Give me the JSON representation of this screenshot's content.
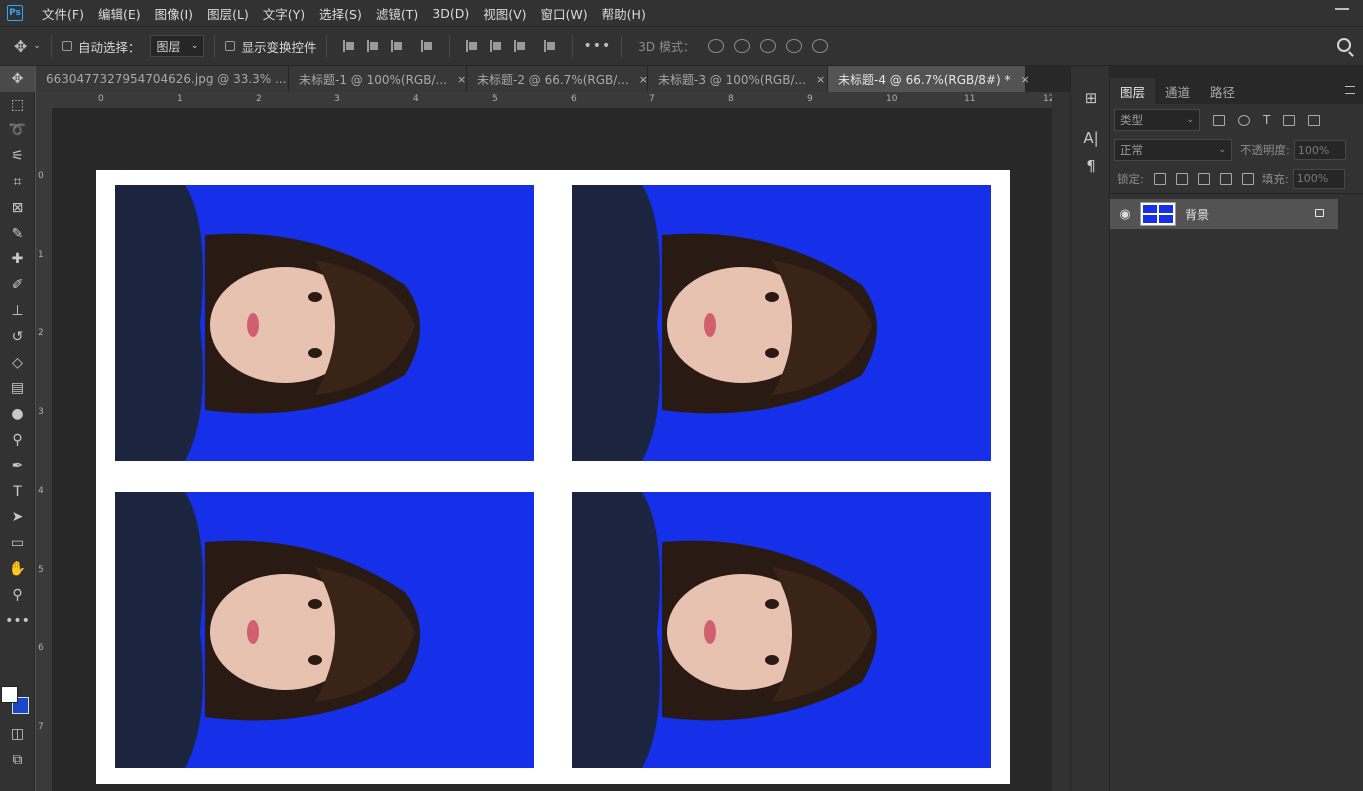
{
  "menubar": {
    "logo": "Ps",
    "items": [
      "文件(F)",
      "编辑(E)",
      "图像(I)",
      "图层(L)",
      "文字(Y)",
      "选择(S)",
      "滤镜(T)",
      "3D(D)",
      "视图(V)",
      "窗口(W)",
      "帮助(H)"
    ]
  },
  "options": {
    "move_tool_icon": "move-icon",
    "auto_select_label": "自动选择：",
    "auto_select_value": "图层",
    "show_transform_label": "显示变换控件",
    "mode_3d_label": "3D 模式："
  },
  "tabs": [
    {
      "label": "6630477327954704626.jpg @ 33.3% ...",
      "close": "×"
    },
    {
      "label": "未标题-1 @ 100%(RGB/...",
      "close": "×"
    },
    {
      "label": "未标题-2 @ 66.7%(RGB/...",
      "close": "×"
    },
    {
      "label": "未标题-3 @ 100%(RGB/...",
      "close": "×"
    },
    {
      "label": "未标题-4 @ 66.7%(RGB/8#) *",
      "close": "×"
    }
  ],
  "ruler": {
    "h_ticks": [
      "0",
      "1",
      "2",
      "3",
      "4",
      "5",
      "6",
      "7",
      "8",
      "9",
      "10",
      "11",
      "12"
    ],
    "v_ticks": [
      "0",
      "1",
      "2",
      "3",
      "4",
      "5",
      "6",
      "7"
    ]
  },
  "document": {
    "background": "#ffffff",
    "photo_bg_color": "#1530e8",
    "photos": [
      "portrait-1",
      "portrait-2",
      "portrait-3",
      "portrait-4"
    ]
  },
  "panel": {
    "tabs": [
      "图层",
      "通道",
      "路径"
    ],
    "filter_label": "类型",
    "blend_mode": "正常",
    "opacity_label": "不透明度:",
    "opacity_value": "100%",
    "lock_label": "锁定:",
    "fill_label": "填充:",
    "fill_value": "100%",
    "layers": [
      {
        "name": "背景",
        "visible": true,
        "locked": true
      }
    ]
  },
  "colors": {
    "foreground": "#ffffff",
    "background": "#1a46c8",
    "accent": "#31a8ff"
  }
}
